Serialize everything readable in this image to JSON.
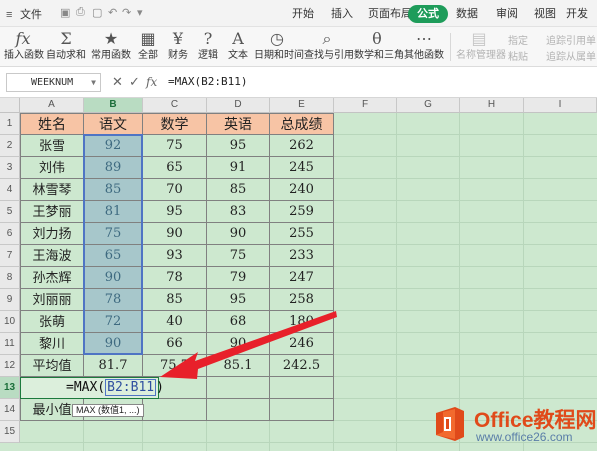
{
  "menubar": {
    "file_label": "文件",
    "tabs": [
      "开始",
      "插入",
      "页面布局",
      "公式",
      "数据",
      "审阅",
      "视图",
      "开发工"
    ],
    "active_tab": "公式"
  },
  "ribbon": {
    "buttons": [
      {
        "label": "插入函数",
        "icon": "fx"
      },
      {
        "label": "自动求和",
        "icon": "Σ"
      },
      {
        "label": "常用函数",
        "icon": "★"
      },
      {
        "label": "全部",
        "icon": "▦"
      },
      {
        "label": "财务",
        "icon": "¥"
      },
      {
        "label": "逻辑",
        "icon": "?"
      },
      {
        "label": "文本",
        "icon": "A"
      },
      {
        "label": "日期和时间",
        "icon": "◷"
      },
      {
        "label": "查找与引用",
        "icon": "⌕"
      },
      {
        "label": "数学和三角",
        "icon": "θ"
      },
      {
        "label": "其他函数",
        "icon": "⋯"
      },
      {
        "label": "名称管理器",
        "icon": "▤"
      }
    ],
    "small_right": [
      "指定",
      "粘贴",
      "追踪引用单",
      "追踪从属单"
    ]
  },
  "formula_bar": {
    "name_box": "WEEKNUM",
    "formula": "=MAX(B2:B11)"
  },
  "grid": {
    "columns": [
      "A",
      "B",
      "C",
      "D",
      "E",
      "F",
      "G",
      "H",
      "I"
    ],
    "rows": [
      "1",
      "2",
      "3",
      "4",
      "5",
      "6",
      "7",
      "8",
      "9",
      "10",
      "11",
      "12",
      "13",
      "14",
      "15"
    ],
    "header": [
      "姓名",
      "语文",
      "数学",
      "英语",
      "总成绩"
    ],
    "data": [
      [
        "张雪",
        "92",
        "75",
        "95",
        "262"
      ],
      [
        "刘伟",
        "89",
        "65",
        "91",
        "245"
      ],
      [
        "林雪琴",
        "85",
        "70",
        "85",
        "240"
      ],
      [
        "王梦丽",
        "81",
        "95",
        "83",
        "259"
      ],
      [
        "刘力扬",
        "75",
        "90",
        "90",
        "255"
      ],
      [
        "王海波",
        "65",
        "93",
        "75",
        "233"
      ],
      [
        "孙杰辉",
        "90",
        "78",
        "79",
        "247"
      ],
      [
        "刘丽丽",
        "78",
        "85",
        "95",
        "258"
      ],
      [
        "张萌",
        "72",
        "40",
        "68",
        "180"
      ],
      [
        "黎川",
        "90",
        "66",
        "90",
        "246"
      ]
    ],
    "avg_row": [
      "平均值",
      "81.7",
      "75.7",
      "85.1",
      "242.5"
    ],
    "edit_prefix": "=MAX(",
    "edit_ref": "B2:B11",
    "edit_suffix": ")",
    "min_label": "最小值",
    "tooltip": "MAX (数值1, ...)"
  },
  "watermark": {
    "title": "Office教程网",
    "url": "www.office26.com"
  },
  "colors": {
    "header_fill": "#f7c4a5",
    "sheet_fill": "#cde8cf",
    "selection_fill": "#a7c7cb",
    "accent": "#1e9c5a",
    "arrow": "#e8202a"
  }
}
